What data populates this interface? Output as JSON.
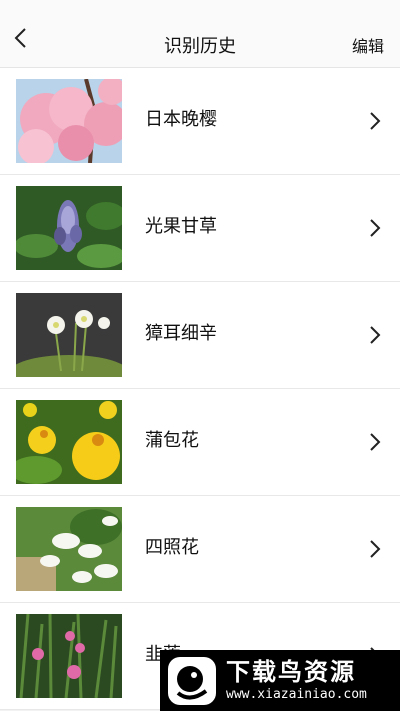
{
  "header": {
    "title": "识别历史",
    "edit_label": "编辑",
    "back_icon": "chevron-left-icon"
  },
  "items": [
    {
      "name": "日本晚樱",
      "thumb": "cherry-blossom"
    },
    {
      "name": "光果甘草",
      "thumb": "licorice-flower"
    },
    {
      "name": "獐耳细辛",
      "thumb": "hepatica-flower"
    },
    {
      "name": "蒲包花",
      "thumb": "calceolaria-flower"
    },
    {
      "name": "四照花",
      "thumb": "dogwood-flower"
    },
    {
      "name": "韭莲",
      "thumb": "rain-lily"
    }
  ],
  "watermark": {
    "brand": "下载鸟资源",
    "url": "www.xiazainiao.com"
  },
  "colors": {
    "background": "#f2f2f2",
    "row": "#ffffff",
    "header": "#fafafa"
  }
}
